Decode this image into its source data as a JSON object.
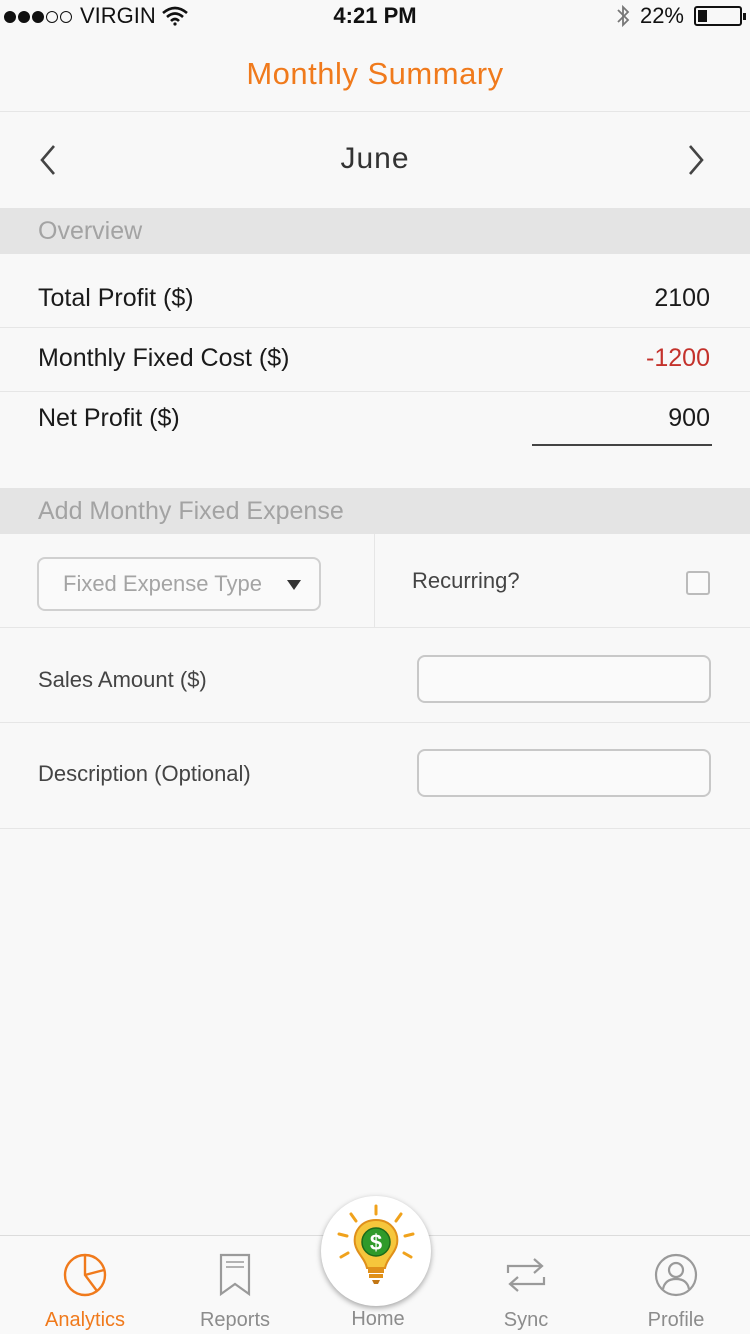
{
  "status_bar": {
    "carrier": "VIRGIN",
    "time": "4:21 PM",
    "battery_percent": "22%",
    "signal_bars": 3,
    "battery_level": 0.22
  },
  "header": {
    "title": "Monthly Summary"
  },
  "month_nav": {
    "month": "June"
  },
  "overview": {
    "section_title": "Overview",
    "rows": [
      {
        "label": "Total Profit ($)",
        "value": "2100"
      },
      {
        "label": "Monthly Fixed Cost ($)",
        "value": "-1200"
      },
      {
        "label": "Net Profit ($)",
        "value": "900"
      }
    ]
  },
  "expense_form": {
    "section_title": "Add Monthy Fixed Expense",
    "type_select": {
      "placeholder": "Fixed Expense Type"
    },
    "recurring": {
      "label": "Recurring?",
      "checked": false
    },
    "sales_amount": {
      "label": "Sales Amount ($)",
      "value": ""
    },
    "description": {
      "label": "Description (Optional)",
      "value": ""
    }
  },
  "tabbar": {
    "tabs": [
      {
        "label": "Analytics",
        "icon": "pie-chart-icon",
        "active": true
      },
      {
        "label": "Reports",
        "icon": "bookmark-icon",
        "active": false
      },
      {
        "label": "Home",
        "icon": "lightbulb-dollar-icon",
        "active": false
      },
      {
        "label": "Sync",
        "icon": "sync-arrows-icon",
        "active": false
      },
      {
        "label": "Profile",
        "icon": "user-avatar-icon",
        "active": false
      }
    ]
  },
  "colors": {
    "accent": "#f07a1c",
    "negative": "#c4322c",
    "section_bg": "#e4e4e4",
    "background": "#f8f8f8"
  }
}
